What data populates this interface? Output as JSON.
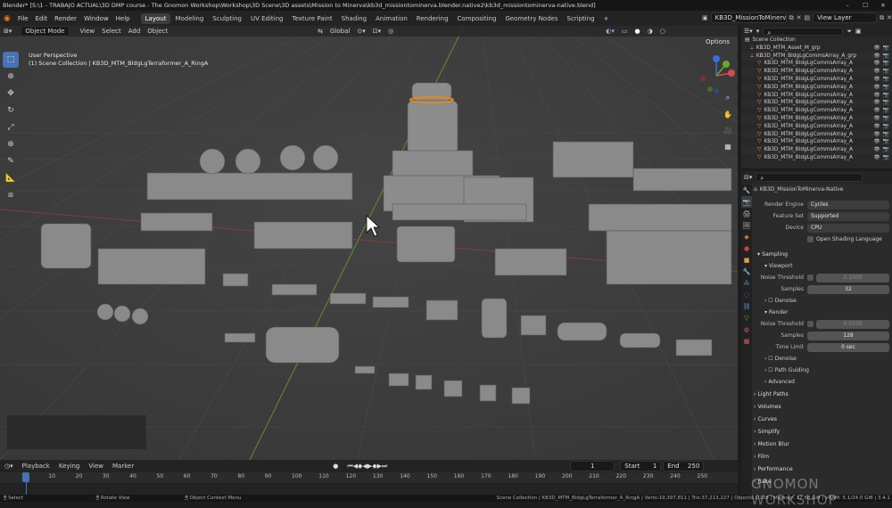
{
  "window": {
    "title": "Blender* [S:\\1 - TRABAJO ACTUAL\\3D DMP course - The Gnomon Workshop\\Workshop\\3D Scene\\3D assets\\Mission to Minerva\\kb3d_missiontominerva.blender.native2\\kb3d_missiontominerva-native.blend]"
  },
  "menu": [
    "File",
    "Edit",
    "Render",
    "Window",
    "Help"
  ],
  "workspaces": {
    "tabs": [
      "Layout",
      "Modeling",
      "Sculpting",
      "UV Editing",
      "Texture Paint",
      "Shading",
      "Animation",
      "Rendering",
      "Compositing",
      "Geometry Nodes",
      "Scripting",
      "+"
    ],
    "active": "Layout"
  },
  "scene_field": "KB3D_MissionToMinerva-...",
  "view_layer": "View Layer",
  "viewport": {
    "mode": "Object Mode",
    "menus": [
      "View",
      "Select",
      "Add",
      "Object"
    ],
    "orientation": "Global",
    "options_label": "Options",
    "perspective": "User Perspective",
    "collection_info": "(1) Scene Collection | KB3D_MTM_BldgLgTerraformer_A_RingA"
  },
  "outliner": {
    "root": "Scene Collection",
    "items": [
      "KB3D_MTM_Asset_M_grp",
      "KB3D_MTM_BldgLgCommsArray_A_grp",
      "KB3D_MTM_BldgLgCommsArray_A",
      "KB3D_MTM_BldgLgCommsArray_A",
      "KB3D_MTM_BldgLgCommsArray_A",
      "KB3D_MTM_BldgLgCommsArray_A",
      "KB3D_MTM_BldgLgCommsArray_A",
      "KB3D_MTM_BldgLgCommsArray_A",
      "KB3D_MTM_BldgLgCommsArray_A",
      "KB3D_MTM_BldgLgCommsArray_A",
      "KB3D_MTM_BldgLgCommsArray_A",
      "KB3D_MTM_BldgLgCommsArray_A",
      "KB3D_MTM_BldgLgCommsArray_A",
      "KB3D_MTM_BldgLgCommsArray_A",
      "KB3D_MTM_BldgLgCommsArray_A"
    ]
  },
  "properties": {
    "scene_name": "KB3D_MissionToMinerva-Native",
    "render_engine_label": "Render Engine",
    "render_engine": "Cycles",
    "feature_set_label": "Feature Set",
    "feature_set": "Supported",
    "device_label": "Device",
    "device": "CPU",
    "osl": "Open Shading Language",
    "sampling": "Sampling",
    "viewport": "Viewport",
    "noise_threshold_label": "Noise Threshold",
    "viewport_noise": "0.1000",
    "samples_label": "Samples",
    "viewport_samples": "32",
    "denoise": "Denoise",
    "render": "Render",
    "render_noise": "0.0100",
    "render_samples": "128",
    "time_limit_label": "Time Limit",
    "time_limit": "0 sec",
    "path_guiding": "Path Guiding",
    "advanced": "Advanced",
    "panels": [
      "Light Paths",
      "Volumes",
      "Curves",
      "Simplify",
      "Motion Blur",
      "Film",
      "Performance",
      "Bake"
    ]
  },
  "timeline": {
    "menus": [
      "Playback",
      "Keying",
      "View",
      "Marker"
    ],
    "current_frame": "1",
    "start_label": "Start",
    "start": "1",
    "end_label": "End",
    "end": "250",
    "ticks": [
      "1",
      "10",
      "20",
      "30",
      "40",
      "50",
      "60",
      "70",
      "80",
      "90",
      "100",
      "110",
      "120",
      "130",
      "140",
      "150",
      "160",
      "170",
      "180",
      "190",
      "200",
      "210",
      "220",
      "230",
      "240",
      "250"
    ]
  },
  "statusbar": {
    "select": "Select",
    "rotate": "Rotate View",
    "context": "Object Context Menu",
    "stats": "Scene Collection | KB3D_MTM_BldgLgTerraformer_A_RingA | Verts:19,397,811 | Tris:37,213,227 | Objects:1/208 | Memory: 12.88 GiB | VRAM: 5.1/24.0 GiB | 3.4.1"
  },
  "watermark": "GNOMON WORKSHOP",
  "colors": {
    "accent": "#4772b3",
    "selection": "#e08a1e",
    "x_axis": "#8a3a3a",
    "y_axis": "#6b8a2a"
  }
}
